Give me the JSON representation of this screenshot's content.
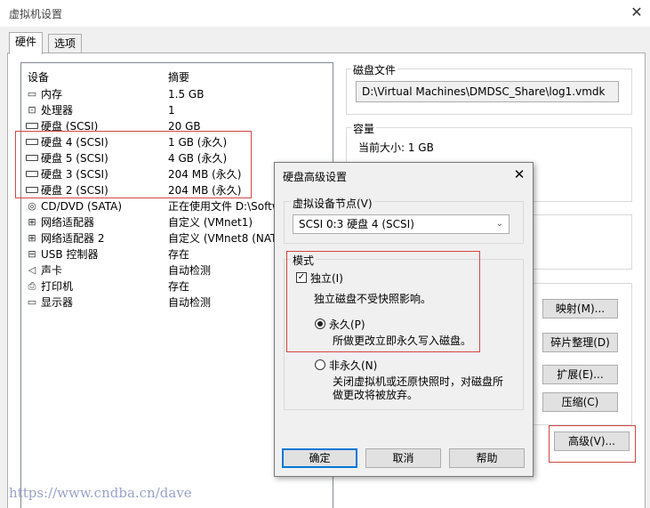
{
  "window": {
    "title": "虚拟机设置",
    "close": "✕"
  },
  "tabs": [
    {
      "label": "硬件"
    },
    {
      "label": "选项"
    }
  ],
  "devices": {
    "headers": {
      "device": "设备",
      "summary": "摘要"
    },
    "rows": [
      {
        "icon": "memory-icon",
        "name": "内存",
        "summary": "1.5 GB"
      },
      {
        "icon": "cpu-icon",
        "name": "处理器",
        "summary": "1"
      },
      {
        "icon": "hdd-icon",
        "name": "硬盘 (SCSI)",
        "summary": "20 GB"
      },
      {
        "icon": "hdd-icon",
        "name": "硬盘 4 (SCSI)",
        "summary": "1 GB (永久)"
      },
      {
        "icon": "hdd-icon",
        "name": "硬盘 5 (SCSI)",
        "summary": "4 GB (永久)"
      },
      {
        "icon": "hdd-icon",
        "name": "硬盘 3 (SCSI)",
        "summary": "204 MB (永久)"
      },
      {
        "icon": "hdd-icon",
        "name": "硬盘 2 (SCSI)",
        "summary": "204 MB (永久)"
      },
      {
        "icon": "cd-icon",
        "name": "CD/DVD (SATA)",
        "summary": "正在使用文件 D:\\Softw"
      },
      {
        "icon": "network-icon",
        "name": "网络适配器",
        "summary": "自定义 (VMnet1)"
      },
      {
        "icon": "network-icon",
        "name": "网络适配器 2",
        "summary": "自定义 (VMnet8 (NAT"
      },
      {
        "icon": "usb-icon",
        "name": "USB 控制器",
        "summary": "存在"
      },
      {
        "icon": "speaker-icon",
        "name": "声卡",
        "summary": "自动检测"
      },
      {
        "icon": "printer-icon",
        "name": "打印机",
        "summary": "存在"
      },
      {
        "icon": "monitor-icon",
        "name": "显示器",
        "summary": "自动检测"
      }
    ]
  },
  "disk_file": {
    "label": "磁盘文件",
    "path": "D:\\Virtual Machines\\DMDSC_Share\\log1.vmdk"
  },
  "capacity": {
    "label": "容量",
    "current_size": "当前大小: 1 GB"
  },
  "right_buttons": {
    "map": "映射(M)...",
    "defrag": "碎片整理(D)",
    "expand": "扩展(E)...",
    "compact": "压缩(C)",
    "advanced": "高级(V)..."
  },
  "dialog": {
    "title": "硬盘高级设置",
    "close": "✕",
    "node_label": "虚拟设备节点(V)",
    "node_value": "SCSI 0:3   硬盘 4 (SCSI)",
    "mode_label": "模式",
    "independent_label": "独立(I)",
    "independent_checked": true,
    "independent_desc": "独立磁盘不受快照影响。",
    "persistent_label": "永久(P)",
    "persistent_desc": "所做更改立即永久写入磁盘。",
    "nonpersistent_label": "非永久(N)",
    "nonpersistent_desc_1": "关闭虚拟机或还原快照时，对磁盘所",
    "nonpersistent_desc_2": "做更改将被放弃。",
    "ok": "确定",
    "cancel": "取消",
    "help": "帮助"
  },
  "watermark": "https://www.cndba.cn/dave",
  "colors": {
    "highlight_border": "#d64545",
    "focus_button": "#0078d7",
    "watermark": "#9aa2c8"
  }
}
